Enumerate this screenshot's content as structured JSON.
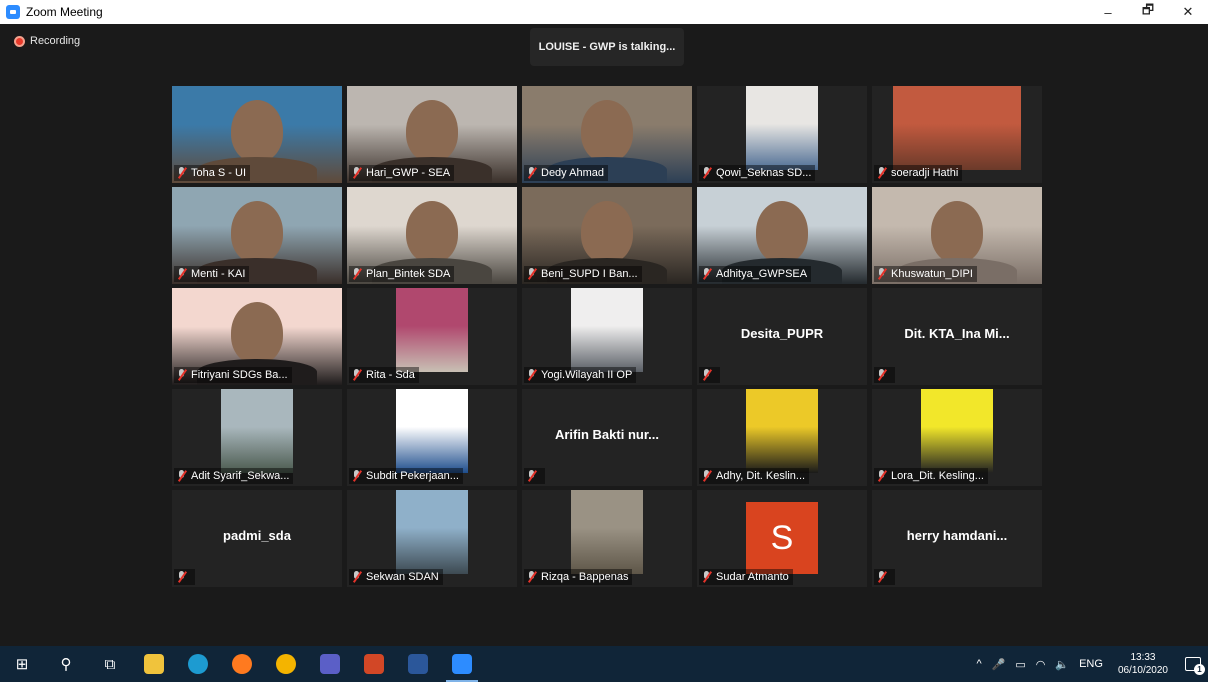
{
  "window": {
    "title": "Zoom Meeting",
    "minimize": "–",
    "restore": "🗗",
    "close": "✕"
  },
  "meeting": {
    "recording_label": "Recording",
    "talking_banner": "LOUISE - GWP is talking...",
    "participants": [
      {
        "name": "Toha S - UI",
        "mode": "video",
        "colors": [
          "#3b7aa8",
          "#5f4a3a"
        ]
      },
      {
        "name": "Hari_GWP - SEA",
        "mode": "video",
        "colors": [
          "#bcb6b0",
          "#3a302a"
        ]
      },
      {
        "name": "Dedy Ahmad",
        "mode": "video",
        "colors": [
          "#8a7c6c",
          "#2c3f55"
        ]
      },
      {
        "name": "Qowi_Seknas SD...",
        "mode": "thumb",
        "colors": [
          "#e8e6e3",
          "#4e6d94"
        ],
        "thumb_w": 72
      },
      {
        "name": "soeradji Hathi",
        "mode": "thumb",
        "colors": [
          "#c25a3f",
          "#6b3a2a"
        ],
        "thumb_w": 128
      },
      {
        "name": "Menti - KAI",
        "mode": "video",
        "colors": [
          "#8fa6b2",
          "#3a2f2a"
        ]
      },
      {
        "name": "Plan_Bintek SDA",
        "mode": "video",
        "colors": [
          "#ded7cf",
          "#4a4640"
        ]
      },
      {
        "name": "Beni_SUPD I Ban...",
        "mode": "video",
        "colors": [
          "#7b6b5b",
          "#2a2622"
        ]
      },
      {
        "name": "Adhitya_GWPSEA",
        "mode": "video",
        "colors": [
          "#c7d0d6",
          "#242a2e"
        ]
      },
      {
        "name": "Khuswatun_DIPI",
        "mode": "video",
        "colors": [
          "#c4b9ae",
          "#7a6e66"
        ]
      },
      {
        "name": "Fitriyani SDGs Ba...",
        "mode": "video",
        "colors": [
          "#f3d7cf",
          "#1f1c1c"
        ]
      },
      {
        "name": "Rita - Sda",
        "mode": "thumb",
        "colors": [
          "#b0486e",
          "#c8c0b4"
        ],
        "thumb_w": 72
      },
      {
        "name": "Yogi.Wilayah II OP",
        "mode": "thumb",
        "colors": [
          "#efeeee",
          "#5a5f66"
        ],
        "thumb_w": 72
      },
      {
        "name": "Desita_PUPR",
        "mode": "name"
      },
      {
        "name": "Dit. KTA_Ina Mi...",
        "mode": "name"
      },
      {
        "name": "Adit Syarif_Sekwa...",
        "mode": "thumb",
        "colors": [
          "#a9b7bd",
          "#4b5a4e"
        ],
        "thumb_w": 72
      },
      {
        "name": "Subdit Pekerjaan...",
        "mode": "thumb",
        "colors": [
          "#ffffff",
          "#1e4d8c"
        ],
        "thumb_w": 72
      },
      {
        "name": "Arifin Bakti nur...",
        "mode": "name"
      },
      {
        "name": "Adhy, Dit. Keslin...",
        "mode": "thumb",
        "colors": [
          "#ecc928",
          "#1a1a1a"
        ],
        "thumb_w": 72
      },
      {
        "name": "Lora_Dit. Kesling...",
        "mode": "thumb",
        "colors": [
          "#f2e72a",
          "#222222"
        ],
        "thumb_w": 72
      },
      {
        "name": "padmi_sda",
        "mode": "name"
      },
      {
        "name": "Sekwan SDAN",
        "mode": "thumb",
        "colors": [
          "#8fb0c9",
          "#3d4a52"
        ],
        "thumb_w": 72
      },
      {
        "name": "Rizqa - Bappenas",
        "mode": "thumb",
        "colors": [
          "#9a9284",
          "#5e5648"
        ],
        "thumb_w": 72
      },
      {
        "name": "Sudar Atmanto",
        "mode": "avatar",
        "initial": "S",
        "colors": [
          "#d9441f",
          "#d9441f"
        ]
      },
      {
        "name": "herry hamdani...",
        "mode": "name"
      }
    ]
  },
  "taskbar": {
    "apps": [
      {
        "name": "windows-start",
        "glyph": "⊞",
        "color": ""
      },
      {
        "name": "search",
        "glyph": "⚲",
        "color": ""
      },
      {
        "name": "task-view",
        "glyph": "⧉",
        "color": ""
      },
      {
        "name": "file-explorer",
        "glyph": "",
        "color": "#f0c33c"
      },
      {
        "name": "edge",
        "glyph": "",
        "color": "#1d9bd1"
      },
      {
        "name": "firefox",
        "glyph": "",
        "color": "#ff7a1f"
      },
      {
        "name": "chrome",
        "glyph": "",
        "color": "#f4b400"
      },
      {
        "name": "teams",
        "glyph": "",
        "color": "#5b5fc7"
      },
      {
        "name": "powerpoint",
        "glyph": "",
        "color": "#d24726"
      },
      {
        "name": "word",
        "glyph": "",
        "color": "#2b579a"
      },
      {
        "name": "zoom",
        "glyph": "",
        "color": "#2d8cff"
      }
    ],
    "tray": {
      "chevron": "^",
      "language": "ENG",
      "time": "13:33",
      "date": "06/10/2020",
      "notification_count": "1"
    }
  }
}
